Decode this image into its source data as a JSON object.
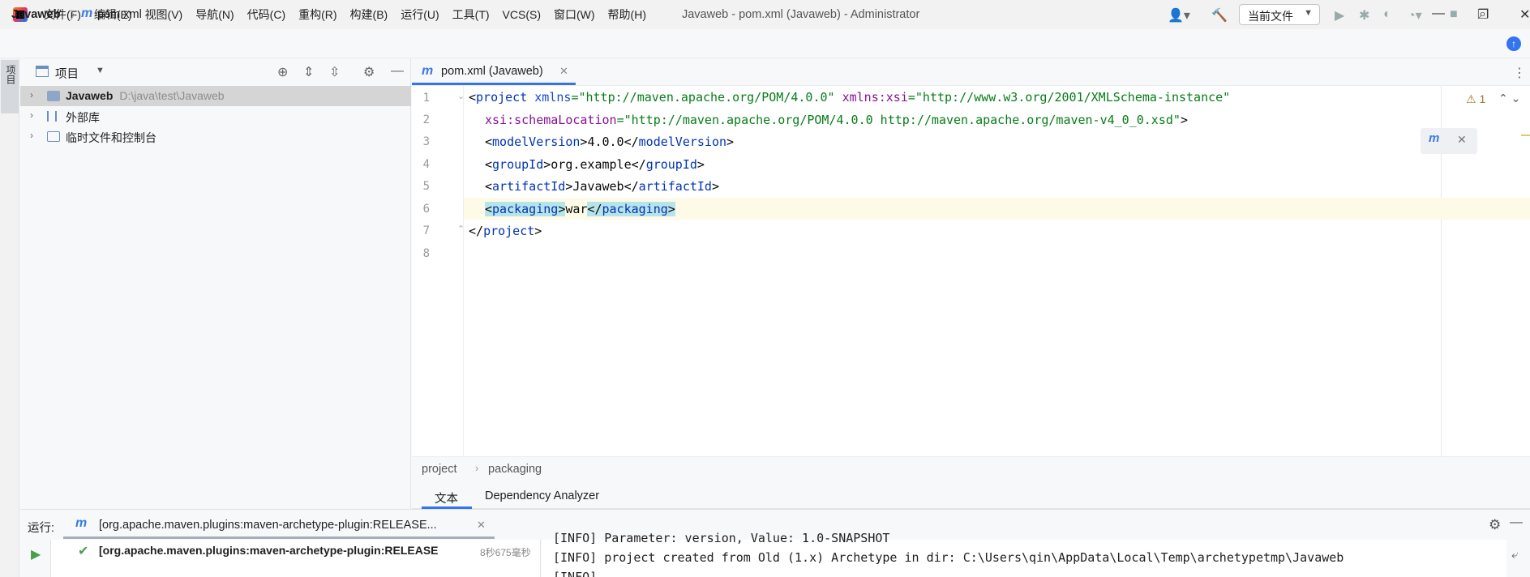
{
  "menubar": {
    "items": [
      "文件(F)",
      "编辑(E)",
      "视图(V)",
      "导航(N)",
      "代码(C)",
      "重构(R)",
      "构建(B)",
      "运行(U)",
      "工具(T)",
      "VCS(S)",
      "窗口(W)",
      "帮助(H)"
    ],
    "window_title": "Javaweb - pom.xml (Javaweb) - Administrator"
  },
  "navbar": {
    "project": "Javaweb",
    "file": "pom.xml",
    "run_config": "当前文件"
  },
  "left_stripe": {
    "project_label": "项目"
  },
  "project_panel": {
    "title": "项目",
    "tree": [
      {
        "label": "Javaweb",
        "path": "D:\\java\\test\\Javaweb"
      },
      {
        "label": "外部库"
      },
      {
        "label": "临时文件和控制台"
      }
    ]
  },
  "editor": {
    "tab_label": "pom.xml (Javaweb)",
    "line_numbers": [
      "1",
      "2",
      "3",
      "4",
      "5",
      "6",
      "7",
      "8"
    ],
    "warning_count": "1",
    "code": {
      "l1_open": "<",
      "l1_tag": "project",
      "l1_attr1": "xmlns",
      "l1_val1": "=\"http://maven.apache.org/POM/4.0.0\"",
      "l1_ns": "xmlns:xsi",
      "l1_val2": "=\"http://www.w3.org/2001/XMLSchema-instance\"",
      "l2_attr": "xsi:schemaLocation",
      "l2_val": "=\"http://maven.apache.org/POM/4.0.0 http://maven.apache.org/maven-v4_0_0.xsd\"",
      "l2_close": ">",
      "l3_tag": "modelVersion",
      "l3_text": "4.0.0",
      "l4_tag": "groupId",
      "l4_text": "org.example",
      "l5_tag": "artifactId",
      "l5_text": "Javaweb",
      "l6_tag": "packaging",
      "l6_text": "war",
      "l7_tag": "project"
    },
    "breadcrumb": [
      "project",
      "packaging"
    ],
    "bottom_tabs": [
      "文本",
      "Dependency Analyzer"
    ]
  },
  "run_window": {
    "label": "运行:",
    "tab_label": "[org.apache.maven.plugins:maven-archetype-plugin:RELEASE...",
    "task": "[org.apache.maven.plugins:maven-archetype-plugin:RELEASE",
    "elapsed": "8秒675毫秒",
    "console": [
      "[INFO] Parameter: version, Value: 1.0-SNAPSHOT",
      "[INFO] project created from Old (1.x) Archetype in dir: C:\\Users\\qin\\AppData\\Local\\Temp\\archetypetmp\\Javaweb",
      "[INFO] ------------------------------------------------------------------------"
    ]
  }
}
